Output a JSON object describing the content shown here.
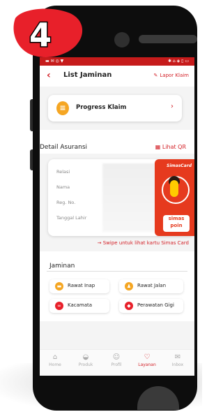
{
  "step_badge": {
    "number": "4",
    "color": "#e8202a"
  },
  "status_bar": {
    "left_icons": "▬ ✉ ◎ ▼",
    "right_icons": "✱ ⌂ ◈ ▯ ▭"
  },
  "header": {
    "back_icon": "chevron-left",
    "title": "List Jaminan",
    "lapor_label": "Lapor Klaim"
  },
  "progress": {
    "label": "Progress Klaim"
  },
  "detail": {
    "title": "Detail Asuransi",
    "lihat_qr": "Lihat QR",
    "fields": [
      "Relasi",
      "Nama",
      "Reg. No.",
      "Tanggal Lahir"
    ],
    "card": {
      "brand": "SimasCard",
      "logo_line1": "simas",
      "logo_line2": "poin"
    }
  },
  "swipe_hint": "→ Swipe untuk lihat kartu Simas Card",
  "jaminan": {
    "title": "Jaminan",
    "items": [
      {
        "label": "Rawat Inap",
        "icon": "bed-icon",
        "color": "#f5a623"
      },
      {
        "label": "Rawat Jalan",
        "icon": "walk-icon",
        "color": "#f5a623"
      },
      {
        "label": "Kacamata",
        "icon": "glasses-icon",
        "color": "#e8202a"
      },
      {
        "label": "Perawatan Gigi",
        "icon": "tooth-icon",
        "color": "#e8202a"
      }
    ]
  },
  "bottom_nav": [
    {
      "label": "Home",
      "icon": "home-icon"
    },
    {
      "label": "Produk",
      "icon": "bag-icon"
    },
    {
      "label": "Profil",
      "icon": "user-icon"
    },
    {
      "label": "Layanan",
      "icon": "heart-shield-icon"
    },
    {
      "label": "Inbox",
      "icon": "mail-icon"
    }
  ],
  "colors": {
    "accent": "#d32027",
    "status_bar": "#c61b1b"
  }
}
